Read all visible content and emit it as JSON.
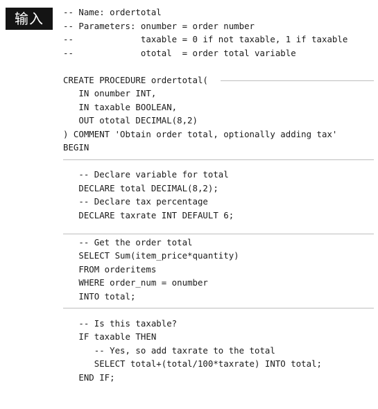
{
  "badge": "输入",
  "header_lines": [
    "-- Name: ordertotal",
    "-- Parameters: onumber = order number",
    "--             taxable = 0 if not taxable, 1 if taxable",
    "--             ototal  = order total variable"
  ],
  "procedure_lines": [
    "CREATE PROCEDURE ordertotal(",
    "   IN onumber INT,",
    "   IN taxable BOOLEAN,",
    "   OUT ototal DECIMAL(8,2)",
    ") COMMENT 'Obtain order total, optionally adding tax'",
    "BEGIN"
  ],
  "declare_lines": [
    "   -- Declare variable for total",
    "   DECLARE total DECIMAL(8,2);",
    "   -- Declare tax percentage",
    "   DECLARE taxrate INT DEFAULT 6;"
  ],
  "select_lines": [
    "   -- Get the order total",
    "   SELECT Sum(item_price*quantity)",
    "   FROM orderitems",
    "   WHERE order_num = onumber",
    "   INTO total;"
  ],
  "tax_lines": [
    "   -- Is this taxable?",
    "   IF taxable THEN",
    "      -- Yes, so add taxrate to the total",
    "      SELECT total+(total/100*taxrate) INTO total;",
    "   END IF;"
  ]
}
